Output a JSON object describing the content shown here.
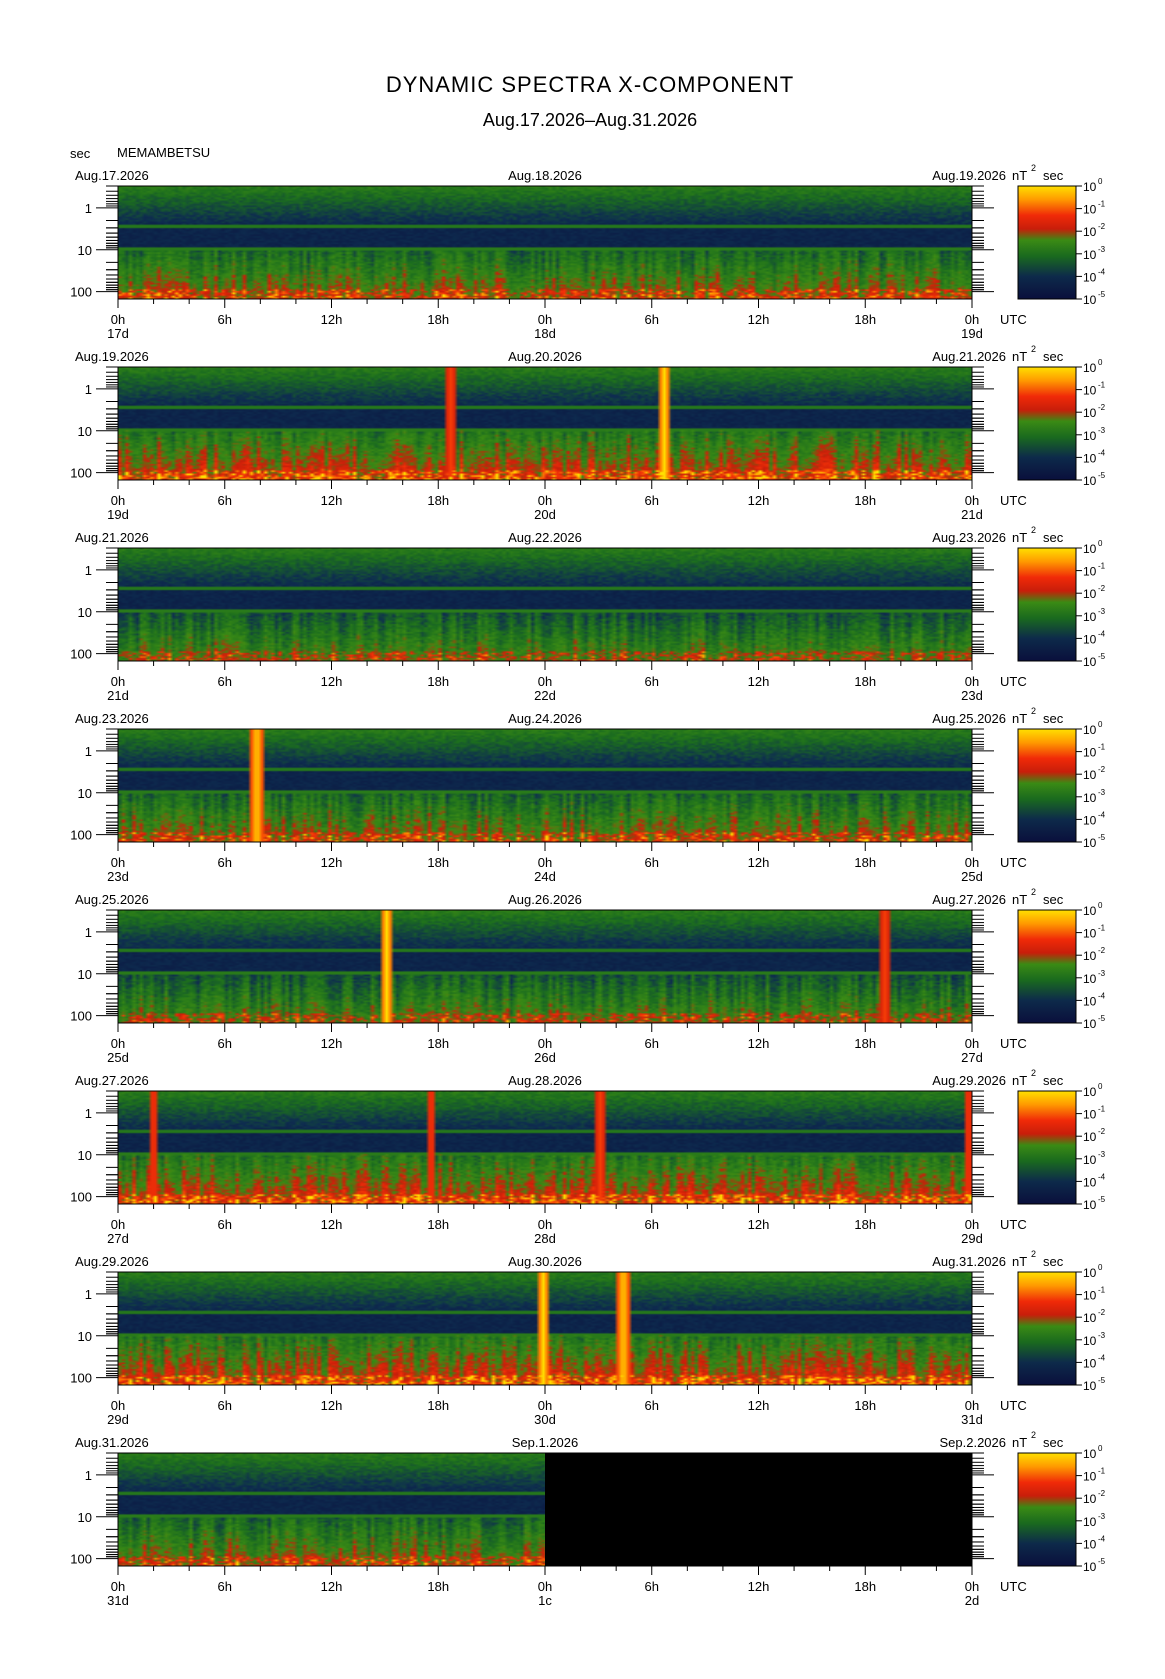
{
  "title": "DYNAMIC SPECTRA X-COMPONENT",
  "subtitle": "Aug.17.2026–Aug.31.2026",
  "station": "MEMAMBETSU",
  "y_axis_unit": "sec",
  "colorbar_unit_prefix": "nT",
  "colorbar_unit_exp": "2",
  "colorbar_unit_suffix": "sec",
  "utc_label": "UTC",
  "colors": {
    "low": "#0a0f3c",
    "mid": "#1f7a1f",
    "high": "#e81a0a",
    "top": "#ffd800",
    "empty": "#000000"
  },
  "chart_data": {
    "type": "heatmap",
    "x_tick_labels": [
      "0h",
      "6h",
      "12h",
      "18h",
      "0h",
      "6h",
      "12h",
      "18h",
      "0h"
    ],
    "y_tick_labels": [
      "1",
      "10",
      "100"
    ],
    "colorbar_tick_base": "10",
    "colorbar_tick_exponents": [
      "0",
      "-1",
      "-2",
      "-3",
      "-4",
      "-5"
    ],
    "ylim": [
      0.3,
      150
    ],
    "y_scale": "log",
    "panels": [
      {
        "date_left": "Aug.17.2026",
        "date_mid": "Aug.18.2026",
        "date_right": "Aug.19.2026",
        "day_left": "17d",
        "day_mid": "18d",
        "day_right": "19d",
        "data_fraction": 1.0,
        "activity": "moderate, rising toward end",
        "events": []
      },
      {
        "date_left": "Aug.19.2026",
        "date_mid": "Aug.20.2026",
        "date_right": "Aug.21.2026",
        "day_left": "19d",
        "day_mid": "20d",
        "day_right": "21d",
        "data_fraction": 1.0,
        "activity": "strong at start and end",
        "events": [
          {
            "time_h": 18.6,
            "intensity": "high"
          },
          {
            "time_h": 30.6,
            "intensity": "very high"
          }
        ]
      },
      {
        "date_left": "Aug.21.2026",
        "date_mid": "Aug.22.2026",
        "date_right": "Aug.23.2026",
        "day_left": "21d",
        "day_mid": "22d",
        "day_right": "23d",
        "data_fraction": 1.0,
        "activity": "quiet",
        "events": []
      },
      {
        "date_left": "Aug.23.2026",
        "date_mid": "Aug.24.2026",
        "date_right": "Aug.25.2026",
        "day_left": "23d",
        "day_mid": "24d",
        "day_right": "25d",
        "data_fraction": 1.0,
        "activity": "moderate early, quiet later",
        "events": [
          {
            "time_h": 7.7,
            "intensity": "very high"
          }
        ]
      },
      {
        "date_left": "Aug.25.2026",
        "date_mid": "Aug.26.2026",
        "date_right": "Aug.27.2026",
        "day_left": "25d",
        "day_mid": "26d",
        "day_right": "27d",
        "data_fraction": 1.0,
        "activity": "quiet",
        "events": [
          {
            "time_h": 15.0,
            "intensity": "very high"
          },
          {
            "time_h": 43.0,
            "intensity": "high"
          }
        ]
      },
      {
        "date_left": "Aug.27.2026",
        "date_mid": "Aug.28.2026",
        "date_right": "Aug.29.2026",
        "day_left": "27d",
        "day_mid": "28d",
        "day_right": "29d",
        "data_fraction": 1.0,
        "activity": "disturbed around 17h-28h, strong after 13h day 2",
        "events": [
          {
            "time_h": 1.9,
            "intensity": "high"
          },
          {
            "time_h": 17.5,
            "intensity": "high"
          },
          {
            "time_h": 27.0,
            "intensity": "high"
          },
          {
            "time_h": 47.7,
            "intensity": "high"
          }
        ]
      },
      {
        "date_left": "Aug.29.2026",
        "date_mid": "Aug.30.2026",
        "date_right": "Aug.31.2026",
        "day_left": "29d",
        "day_mid": "30d",
        "day_right": "31d",
        "data_fraction": 1.0,
        "activity": "moderate to strong",
        "events": [
          {
            "time_h": 23.8,
            "intensity": "very high"
          },
          {
            "time_h": 28.3,
            "intensity": "very high"
          }
        ]
      },
      {
        "date_left": "Aug.31.2026",
        "date_mid": "Sep.1.2026",
        "date_right": "Sep.2.2026",
        "day_left": "31d",
        "day_mid": "1c",
        "day_right": "2d",
        "data_fraction": 0.5,
        "activity": "moderate, data ends at 24h",
        "events": []
      }
    ]
  }
}
